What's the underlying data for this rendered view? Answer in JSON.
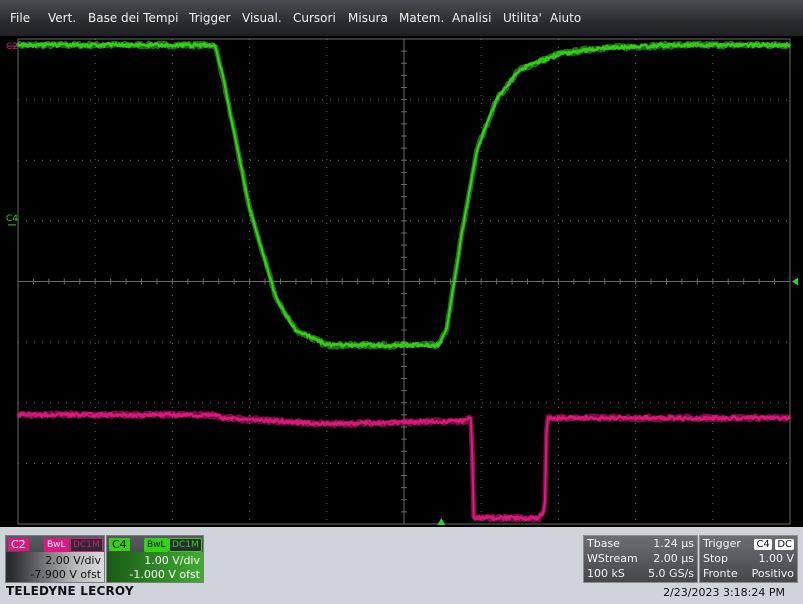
{
  "menu": {
    "items": [
      "File",
      "Vert.",
      "Base dei Tempi",
      "Trigger",
      "Visual.",
      "Cursori",
      "Misura",
      "Matem.",
      "Analisi",
      "Utilita'",
      "Aiuto"
    ]
  },
  "colors": {
    "c4": "#35d11a",
    "c2": "#e0177f",
    "grid": "#6a6a6a",
    "trigger_marker": "#33cc33"
  },
  "channels": {
    "c4": {
      "label": "C4",
      "bwl": "BwL",
      "coupling": "DC1M",
      "vdiv": "1.00 V/div",
      "offset": "-1.000 V ofst"
    },
    "c2": {
      "label": "C2",
      "bwl": "BwL",
      "coupling": "DC1M",
      "vdiv": "2.00 V/div",
      "offset": "-7.900 V ofst"
    }
  },
  "timebase": {
    "title": "Tbase",
    "tbase_value": "1.24 µs",
    "mode": "WStream",
    "tdiv": "2.00 µs",
    "samples": "100 kS",
    "rate": "5.0 GS/s"
  },
  "trigger": {
    "title": "Trigger",
    "source": "C4",
    "coupling": "DC",
    "state": "Stop",
    "level": "1.00 V",
    "type": "Fronte",
    "slope": "Positivo"
  },
  "footer": {
    "brand": "TELEDYNE LECROY",
    "timestamp": "2/23/2023 3:18:24 PM"
  },
  "chart_data": {
    "type": "line",
    "title": "",
    "xlabel": "",
    "ylabel": "",
    "divisions": {
      "x": 10,
      "y": 8
    },
    "time_per_div_us": 2.0,
    "xlim_us": [
      -10,
      10
    ],
    "series": [
      {
        "name": "C4",
        "volts_per_div": 1.0,
        "offset_v": -1.0,
        "x_us": [
          -10,
          -4.9,
          -4.7,
          -4.0,
          -3.3,
          -2.8,
          -2.0,
          0.9,
          1.1,
          1.5,
          1.9,
          2.4,
          3.0,
          4.0,
          5.0,
          7.0,
          10
        ],
        "y_div": [
          3.9,
          3.9,
          3.4,
          1.2,
          -0.3,
          -0.8,
          -1.05,
          -1.05,
          -0.8,
          0.8,
          2.2,
          3.0,
          3.5,
          3.75,
          3.85,
          3.9,
          3.9
        ]
      },
      {
        "name": "C2",
        "volts_per_div": 2.0,
        "offset_v": -7.9,
        "x_us": [
          -10,
          -4.9,
          -4.7,
          -2.0,
          1.6,
          1.75,
          1.8,
          3.5,
          3.65,
          3.7,
          10
        ],
        "y_div": [
          -2.2,
          -2.2,
          -2.25,
          -2.35,
          -2.3,
          -2.25,
          -3.9,
          -3.9,
          -3.75,
          -2.25,
          -2.25
        ]
      }
    ]
  }
}
